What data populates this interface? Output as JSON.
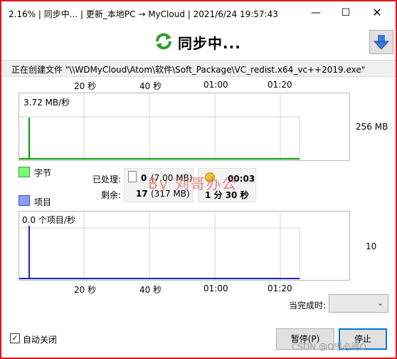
{
  "window": {
    "title": "2.16% | 同步中... | 更新_本地PC → MyCloud | 2021/6/24 19:57:43",
    "minimize_glyph": "—",
    "maximize_glyph": "☐",
    "close_glyph": "✕"
  },
  "header": {
    "title": "同步中...",
    "sync_icon": "sync-icon",
    "collapse_icon": "arrow-down-icon"
  },
  "current_file": "正在创建文件 \"\\\\WDMyCloud\\Atom\\软件\\Soft_Package\\VC_redist.x64_vc++2019.exe\"",
  "top_axis": [
    "20 秒",
    "40 秒",
    "01:00",
    "01:20"
  ],
  "bottom_axis": [
    "20 秒",
    "40 秒",
    "01:00",
    "01:20"
  ],
  "bytes_graph": {
    "rate_label": "3.72 MB/秒",
    "max_label": "256 MB",
    "color": "#00a000"
  },
  "items_graph": {
    "rate_label": "0.0 个项目/秒",
    "max_label": "10",
    "color": "#2020c0"
  },
  "legend": {
    "bytes": {
      "label": "字节",
      "color": "#77ff77"
    },
    "items": {
      "label": "项目",
      "color": "#8899ff"
    }
  },
  "stats": {
    "processed_label": "已处理:",
    "processed_count": "0",
    "processed_size": "(7.00 MB)",
    "elapsed": "00:03",
    "remaining_label": "剩余:",
    "remaining_count": "17",
    "remaining_size": "(317 MB)",
    "remaining_time": "1 分 30 秒"
  },
  "watermark": "By 刘哥办公",
  "finish": {
    "label": "当完成时:",
    "value": ""
  },
  "auto_close": {
    "label": "自动关闭",
    "checked": "✓"
  },
  "buttons": {
    "pause": "暂停(P)",
    "stop": "停止"
  },
  "footer_watermark": "CSDN @Q思必得Q"
}
